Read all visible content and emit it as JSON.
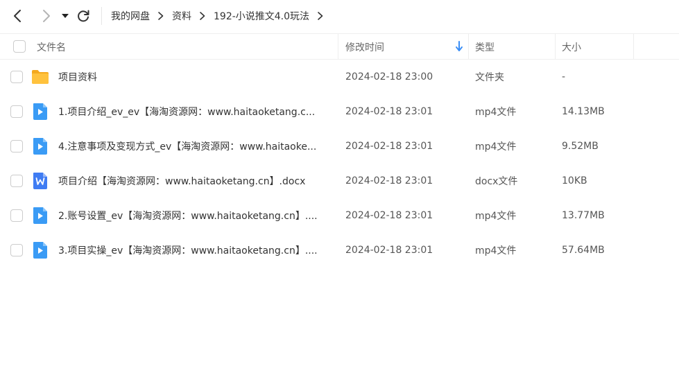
{
  "nav": {
    "back_icon": "chevron-left-icon",
    "forward_icon": "chevron-right-icon",
    "dropdown_icon": "caret-down-icon",
    "refresh_icon": "refresh-icon",
    "breadcrumb": [
      "我的网盘",
      "资料",
      "192-小说推文4.0玩法"
    ]
  },
  "table": {
    "columns": {
      "name": "文件名",
      "modified": "修改时间",
      "type": "类型",
      "size": "大小"
    },
    "sort": {
      "column": "modified",
      "direction": "descending"
    },
    "rows": [
      {
        "icon": "folder-icon",
        "name": "项目资料",
        "modified": "2024-02-18 23:00",
        "type": "文件夹",
        "size": "-"
      },
      {
        "icon": "video-file-icon",
        "name": "1.项目介绍_ev_ev【海淘资源网：www.haitaoketang.c...",
        "modified": "2024-02-18 23:01",
        "type": "mp4文件",
        "size": "14.13MB"
      },
      {
        "icon": "video-file-icon",
        "name": "4.注意事项及变现方式_ev【海淘资源网：www.haitaoke...",
        "modified": "2024-02-18 23:01",
        "type": "mp4文件",
        "size": "9.52MB"
      },
      {
        "icon": "word-doc-icon",
        "name": "项目介绍【海淘资源网：www.haitaoketang.cn】.docx",
        "modified": "2024-02-18 23:01",
        "type": "docx文件",
        "size": "10KB"
      },
      {
        "icon": "video-file-icon",
        "name": "2.账号设置_ev【海淘资源网：www.haitaoketang.cn】....",
        "modified": "2024-02-18 23:01",
        "type": "mp4文件",
        "size": "13.77MB"
      },
      {
        "icon": "video-file-icon",
        "name": "3.项目实操_ev【海淘资源网：www.haitaoketang.cn】....",
        "modified": "2024-02-18 23:01",
        "type": "mp4文件",
        "size": "57.64MB"
      }
    ]
  },
  "colors": {
    "folder": "#FFC23D",
    "video_icon": "#3A9BF5",
    "word_icon": "#3F7CF3",
    "sort_arrow": "#3A8EF6"
  }
}
